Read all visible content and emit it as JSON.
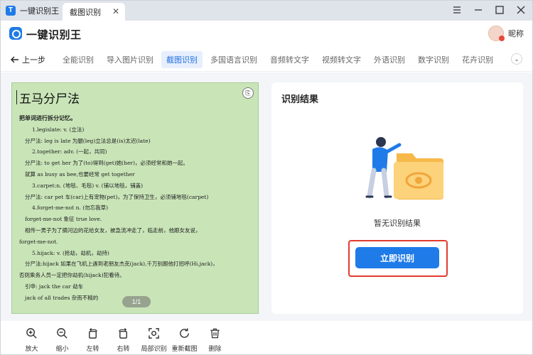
{
  "titlebar": {
    "app_name": "一键识别王",
    "tab_label": "截图识别"
  },
  "header": {
    "title": "一键识别王",
    "nickname": "昵称"
  },
  "nav": {
    "back_label": "上一步",
    "items": [
      "全能识别",
      "导入图片识别",
      "截图识别",
      "多国语言识别",
      "音频转文字",
      "视频转文字",
      "外语识别",
      "数字识别",
      "花卉识别"
    ],
    "active_index": 2
  },
  "document": {
    "title": "五马分尸法",
    "heading": "把单词进行拆分记忆。",
    "lines": [
      "1.legislate: v. (立法)",
      "分尸法: leg is late 为腿(leg)立法总是(is)太迟(late)",
      "2.together: adv. (一起，共同)",
      "分尸法: to get her 为了(to)得到(get)她(her)，必须经常和她一起。",
      "就算 as busy as bee,也要经常 get together",
      "3.carpet:n. (地毯、毛毯) v. (铺以地毯，铺盖)",
      "分尸法: car pet 车(car)上有宠物(pet)，为了保持卫生，必须铺地毯(carpet)",
      "4.forget-me-not n. (勿忘我草)",
      "forget-me-not 象征 true love.",
      "相传一男子为了摘河边的花给女友，被急流冲走了，临走前，他跟女友说，",
      "forget-me-not.",
      "5.hijack: v. (抢劫，劫机，劫持)",
      "分尸法:hijack 如果在飞机上遇到老朋友杰克(jack),千万别跟他打招呼(Hi,jack)，",
      "否则乘务人员一定把你劫机(hijack)犯看待。",
      "引申: jack the car 劫车",
      "jack of all trades 杂而不精的"
    ],
    "page_indicator": "1/1"
  },
  "result": {
    "title": "识别结果",
    "empty_text": "暂无识别结果",
    "button_label": "立即识别"
  },
  "toolbar": {
    "tools": [
      {
        "icon": "zoom-in-icon",
        "label": "放大"
      },
      {
        "icon": "zoom-out-icon",
        "label": "缩小"
      },
      {
        "icon": "rotate-left-icon",
        "label": "左转"
      },
      {
        "icon": "rotate-right-icon",
        "label": "右转"
      },
      {
        "icon": "partial-recognize-icon",
        "label": "局部识别"
      },
      {
        "icon": "recapture-icon",
        "label": "重新截图"
      },
      {
        "icon": "trash-icon",
        "label": "删除"
      }
    ]
  },
  "colors": {
    "accent": "#1f7be8",
    "highlight_outline": "#e23b2f",
    "document_bg": "#c9e5b8"
  }
}
